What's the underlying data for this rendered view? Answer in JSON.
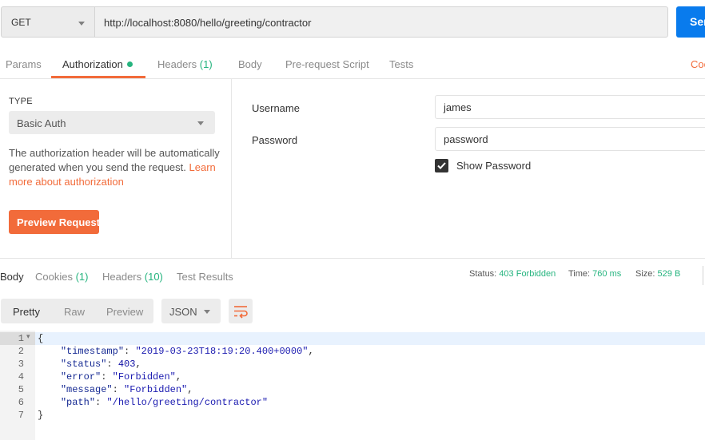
{
  "request": {
    "method": "GET",
    "url": "http://localhost:8080/hello/greeting/contractor",
    "send_label": "Send"
  },
  "request_tabs": [
    {
      "label": "Params"
    },
    {
      "label": "Authorization"
    },
    {
      "label": "Headers",
      "count": "(1)"
    },
    {
      "label": "Body"
    },
    {
      "label": "Pre-request Script"
    },
    {
      "label": "Tests"
    }
  ],
  "cookies_link": "Cookies",
  "auth": {
    "type_label": "TYPE",
    "type_value": "Basic Auth",
    "description": "The authorization header will be automatically generated when you send the request.",
    "learn_more": "Learn more about authorization",
    "preview_button": "Preview Request",
    "username_label": "Username",
    "username_value": "james",
    "password_label": "Password",
    "password_value": "password",
    "show_password_label": "Show Password",
    "show_password_checked": true
  },
  "response_tabs": [
    {
      "label": "Body"
    },
    {
      "label": "Cookies",
      "count": "(1)"
    },
    {
      "label": "Headers",
      "count": "(10)"
    },
    {
      "label": "Test Results"
    }
  ],
  "response_meta": {
    "status_label": "Status:",
    "status_value": "403 Forbidden",
    "time_label": "Time:",
    "time_value": "760 ms",
    "size_label": "Size:",
    "size_value": "529 B"
  },
  "view_modes": [
    "Pretty",
    "Raw",
    "Preview"
  ],
  "format": "JSON",
  "body_lines": [
    {
      "n": "1",
      "text": "{"
    },
    {
      "n": "2",
      "key": "\"timestamp\"",
      "val": "\"2019-03-23T18:19:20.400+0000\"",
      "kind": "str"
    },
    {
      "n": "3",
      "key": "\"status\"",
      "val": "403",
      "kind": "num"
    },
    {
      "n": "4",
      "key": "\"error\"",
      "val": "\"Forbidden\"",
      "kind": "str"
    },
    {
      "n": "5",
      "key": "\"message\"",
      "val": "\"Forbidden\"",
      "kind": "str"
    },
    {
      "n": "6",
      "key": "\"path\"",
      "val": "\"/hello/greeting/contractor\"",
      "kind": "str"
    },
    {
      "n": "7",
      "text": "}"
    }
  ],
  "colors": {
    "accent": "#f26b3a",
    "success": "#26b47f",
    "send": "#097bed"
  }
}
